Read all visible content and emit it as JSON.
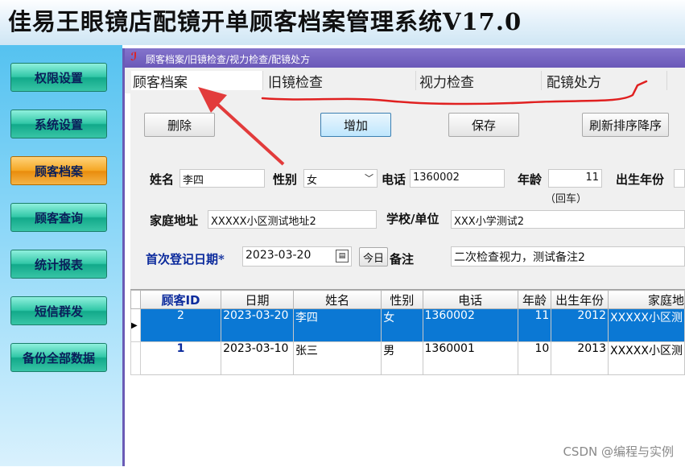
{
  "app": {
    "title": "佳易王眼镜店配镜开单顾客档案管理系统V17.0"
  },
  "nav": [
    {
      "label": "权限设置",
      "active": false
    },
    {
      "label": "系统设置",
      "active": false
    },
    {
      "label": "顾客档案",
      "active": true
    },
    {
      "label": "顾客查询",
      "active": false
    },
    {
      "label": "统计报表",
      "active": false
    },
    {
      "label": "短信群发",
      "active": false
    },
    {
      "label": "备份全部数据",
      "active": false
    }
  ],
  "window": {
    "title": "顾客档案/旧镜检查/视力检查/配镜处方"
  },
  "tabs": [
    {
      "label": "顾客档案",
      "active": true
    },
    {
      "label": "旧镜检查",
      "active": false
    },
    {
      "label": "视力检查",
      "active": false
    },
    {
      "label": "配镜处方",
      "active": false
    }
  ],
  "toolbar": {
    "delete": "删除",
    "add": "增加",
    "save": "保存",
    "refresh": "刷新排序降序"
  },
  "form": {
    "name_label": "姓名",
    "name_value": "李四",
    "gender_label": "性别",
    "gender_value": "女",
    "phone_label": "电话",
    "phone_value": "1360002",
    "age_label": "年龄",
    "age_value": "11",
    "age_hint": "（回车）",
    "birthyear_label": "出生年份",
    "address_label": "家庭地址",
    "address_value": "XXXXX小区测试地址2",
    "school_label": "学校/单位",
    "school_value": "XXX小学测试2",
    "regdate_label": "首次登记日期*",
    "regdate_value": "2023-03-20",
    "today_button": "今日",
    "remark_label": "备注",
    "remark_value": "二次检查视力，测试备注2"
  },
  "table": {
    "columns": [
      "顾客ID",
      "日期",
      "姓名",
      "性别",
      "电话",
      "年龄",
      "出生年份",
      "家庭地"
    ],
    "rows": [
      {
        "id": "2",
        "date": "2023-03-20",
        "name": "李四",
        "gender": "女",
        "phone": "1360002",
        "age": "11",
        "birth": "2012",
        "addr": "XXXXX小区测",
        "selected": true
      },
      {
        "id": "1",
        "date": "2023-03-10",
        "name": "张三",
        "gender": "男",
        "phone": "1360001",
        "age": "10",
        "birth": "2013",
        "addr": "XXXXX小区测",
        "selected": false
      }
    ]
  },
  "watermark": "CSDN @编程与实例",
  "colors": {
    "accent_selected": "#0b78d4",
    "nav_active": "#f5a623",
    "nav_button": "#31c7a7",
    "annotation": "#e02020"
  }
}
